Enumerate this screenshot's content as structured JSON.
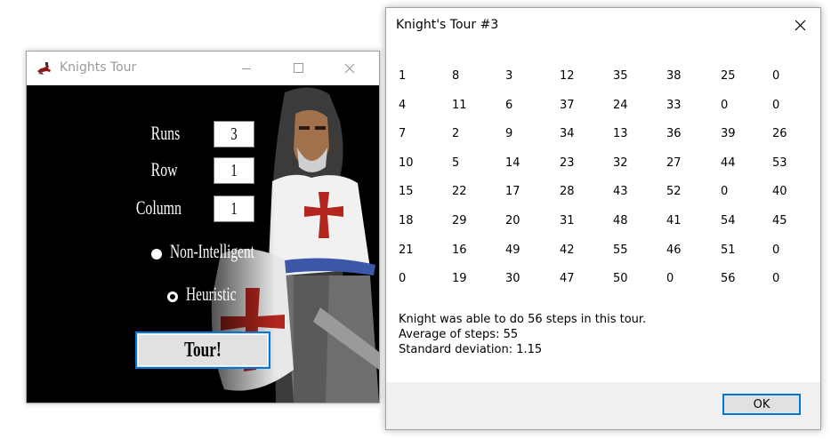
{
  "main_window": {
    "title": "Knights Tour",
    "labels": {
      "runs": "Runs",
      "row": "Row",
      "column": "Column"
    },
    "values": {
      "runs": "3",
      "row": "1",
      "column": "1"
    },
    "options": [
      {
        "label": "Non-Intelligent",
        "selected": true
      },
      {
        "label": "Heuristic",
        "selected": false
      }
    ],
    "tour_button": "Tour!"
  },
  "dialog": {
    "title": "Knight's Tour #3",
    "board": [
      [
        "1",
        "8",
        "3",
        "12",
        "35",
        "38",
        "25",
        "0"
      ],
      [
        "4",
        "11",
        "6",
        "37",
        "24",
        "33",
        "0",
        "0"
      ],
      [
        "7",
        "2",
        "9",
        "34",
        "13",
        "36",
        "39",
        "26"
      ],
      [
        "10",
        "5",
        "14",
        "23",
        "32",
        "27",
        "44",
        "53"
      ],
      [
        "15",
        "22",
        "17",
        "28",
        "43",
        "52",
        "0",
        "40"
      ],
      [
        "18",
        "29",
        "20",
        "31",
        "48",
        "41",
        "54",
        "45"
      ],
      [
        "21",
        "16",
        "49",
        "42",
        "55",
        "46",
        "51",
        "0"
      ],
      [
        "0",
        "19",
        "30",
        "47",
        "50",
        "0",
        "56",
        "0"
      ]
    ],
    "message": [
      "Knight was able to do 56 steps in this tour.",
      "Average of steps: 55",
      "Standard deviation: 1.15"
    ],
    "ok_button": "OK"
  },
  "colors": {
    "accent": "#0078d7",
    "client_background": "#000000",
    "cross_red": "#b3261e"
  },
  "icons": {
    "app": "knight-rider-icon",
    "minimize": "minimize-icon",
    "maximize": "maximize-icon",
    "close": "close-icon"
  }
}
